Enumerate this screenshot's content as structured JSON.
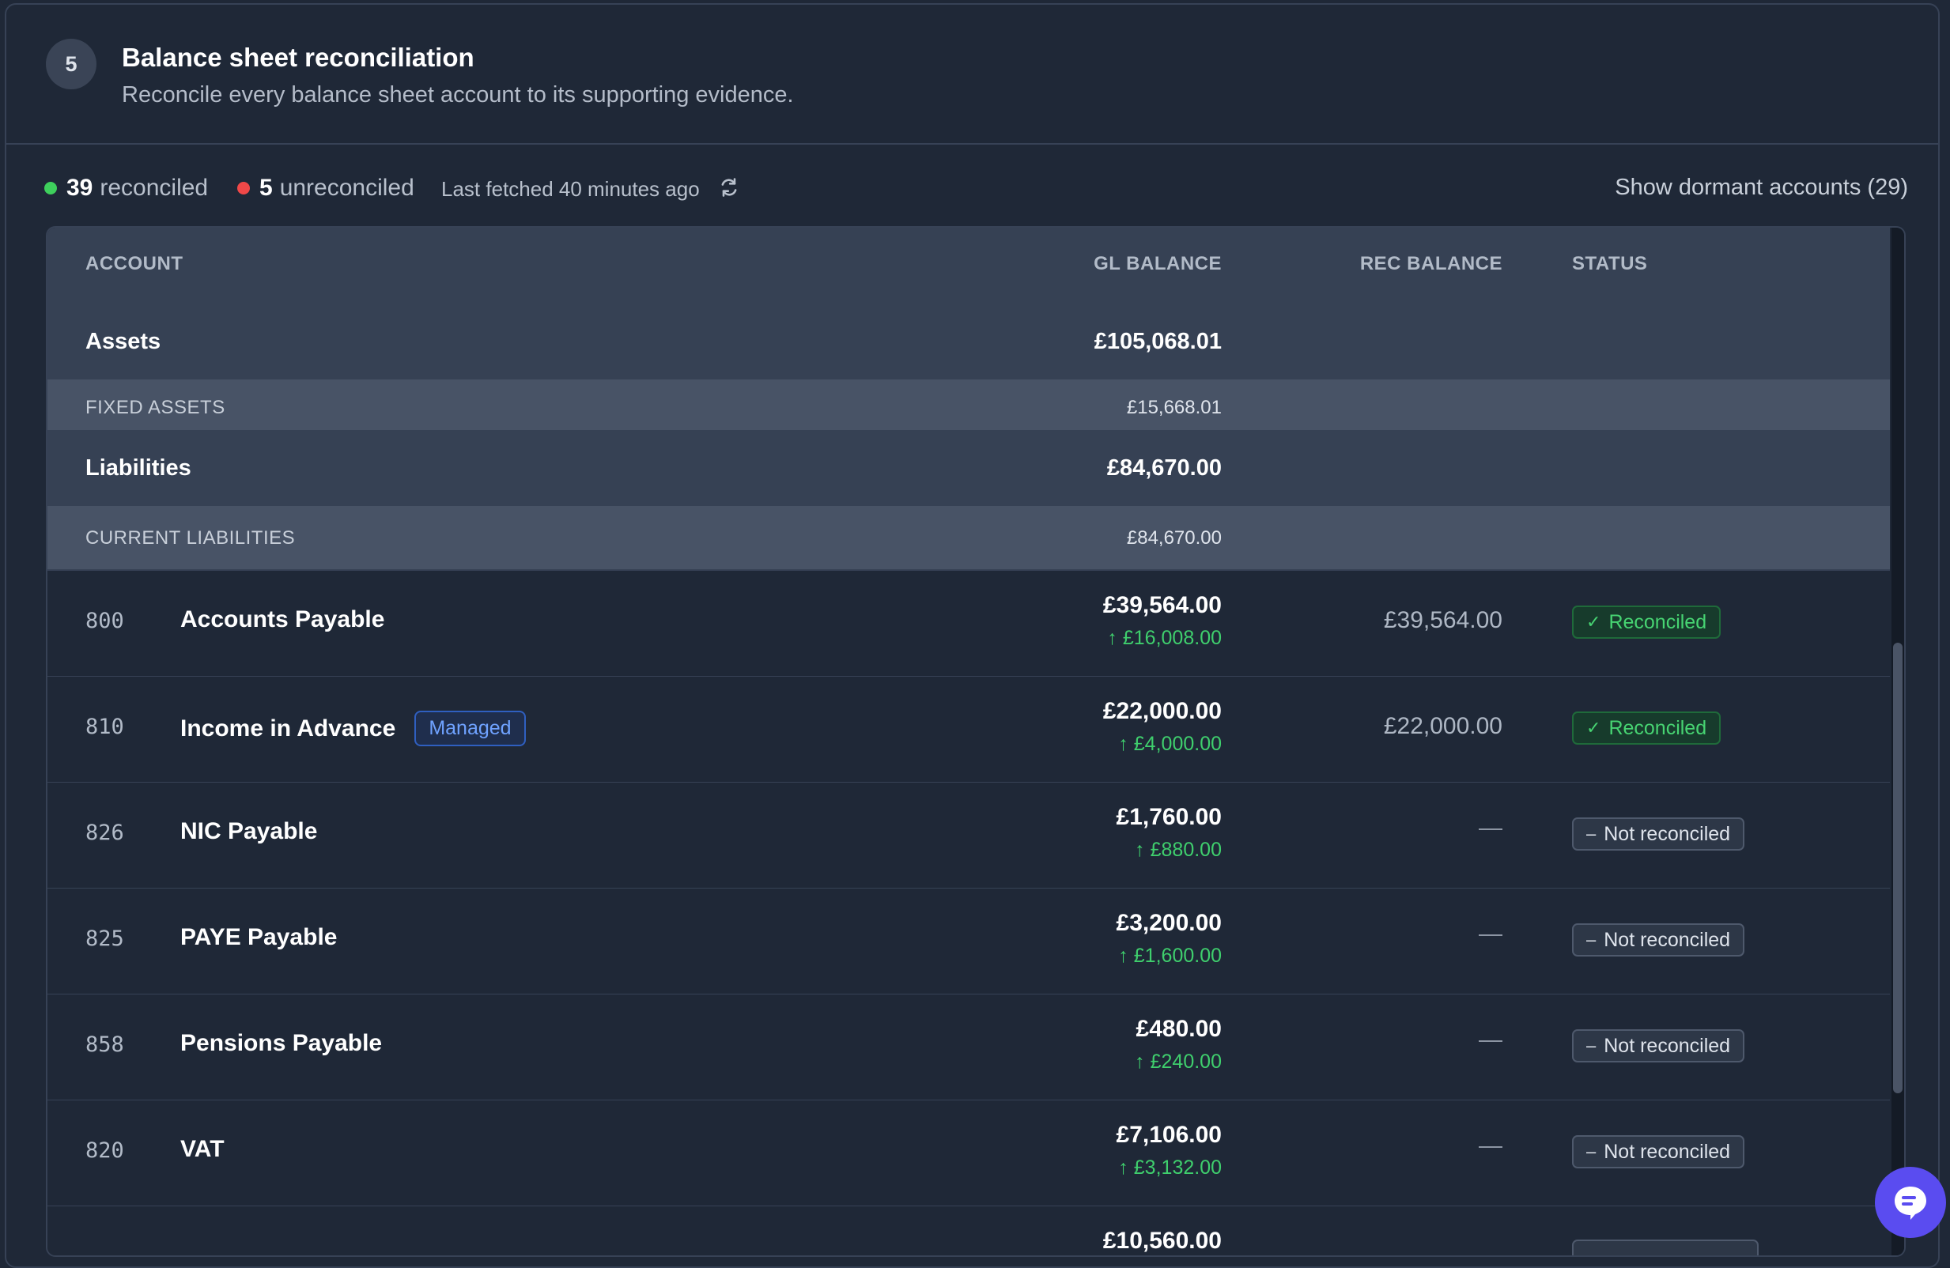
{
  "header": {
    "step": "5",
    "title": "Balance sheet reconciliation",
    "subtitle": "Reconcile every balance sheet account to its supporting evidence."
  },
  "summary": {
    "reconciled_count": "39",
    "reconciled_label": "reconciled",
    "unreconciled_count": "5",
    "unreconciled_label": "unreconciled",
    "last_fetched": "Last fetched 40 minutes ago",
    "dormant_link": "Show dormant accounts (29)"
  },
  "table": {
    "columns": {
      "account": "ACCOUNT",
      "gl_balance": "GL BALANCE",
      "rec_balance": "REC BALANCE",
      "status": "STATUS"
    },
    "assets": {
      "name": "Assets",
      "total": "£105,068.01"
    },
    "fixed_assets": {
      "name": "FIXED ASSETS",
      "total": "£15,668.01"
    },
    "liabilities": {
      "name": "Liabilities",
      "total": "£84,670.00"
    },
    "current_liabilities": {
      "name": "CURRENT LIABILITIES",
      "total": "£84,670.00"
    },
    "accounts": [
      {
        "code": "800",
        "name": "Accounts Payable",
        "gl": "£39,564.00",
        "delta": "£16,008.00",
        "rec": "£39,564.00",
        "status": "Reconciled"
      },
      {
        "code": "810",
        "name": "Income in Advance",
        "badge": "Managed",
        "gl": "£22,000.00",
        "delta": "£4,000.00",
        "rec": "£22,000.00",
        "status": "Reconciled"
      },
      {
        "code": "826",
        "name": "NIC Payable",
        "gl": "£1,760.00",
        "delta": "£880.00",
        "status": "Not reconciled"
      },
      {
        "code": "825",
        "name": "PAYE Payable",
        "gl": "£3,200.00",
        "delta": "£1,600.00",
        "status": "Not reconciled"
      },
      {
        "code": "858",
        "name": "Pensions Payable",
        "gl": "£480.00",
        "delta": "£240.00",
        "status": "Not reconciled"
      },
      {
        "code": "820",
        "name": "VAT",
        "gl": "£7,106.00",
        "delta": "£3,132.00",
        "status": "Not reconciled"
      },
      {
        "gl": "£10,560.00"
      }
    ]
  },
  "colors": {
    "background": "#1f2837",
    "reconciled_green": "#3ecf5c",
    "unreconciled_red": "#f04848",
    "chat_purple": "#5a4cf0"
  },
  "icons": {
    "refresh": "refresh-icon",
    "check": "check-icon",
    "minus": "minus-icon",
    "arrow_up": "arrow-up-icon",
    "chat": "chat-icon"
  }
}
